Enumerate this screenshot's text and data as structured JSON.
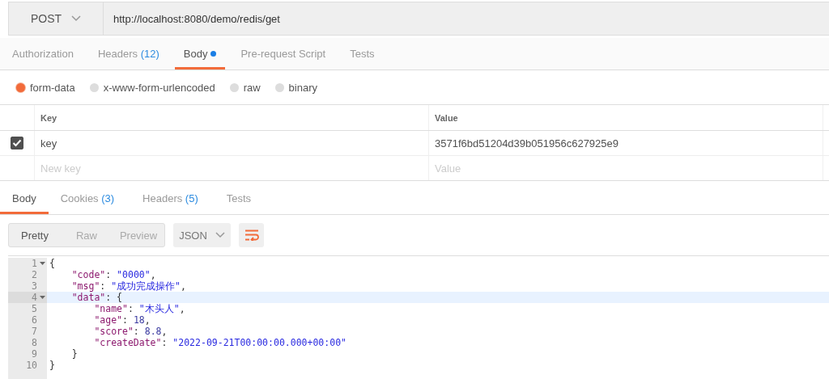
{
  "request": {
    "method": "POST",
    "url": "http://localhost:8080/demo/redis/get"
  },
  "request_tabs": [
    {
      "label": "Authorization",
      "dot": false,
      "selected": false
    },
    {
      "label": "Headers",
      "count": "(12)",
      "dot": false,
      "selected": false
    },
    {
      "label": "Body",
      "dot": true,
      "selected": true
    },
    {
      "label": "Pre-request Script",
      "dot": false,
      "selected": false
    },
    {
      "label": "Tests",
      "dot": false,
      "selected": false
    }
  ],
  "body_types": [
    {
      "label": "form-data",
      "selected": true
    },
    {
      "label": "x-www-form-urlencoded",
      "selected": false
    },
    {
      "label": "raw",
      "selected": false
    },
    {
      "label": "binary",
      "selected": false
    }
  ],
  "params": {
    "columns": [
      "Key",
      "Value"
    ],
    "rows": [
      {
        "checked": true,
        "key": "key",
        "value": "3571f6bd51204d39b051956c627925e9"
      }
    ],
    "new_row": {
      "key_placeholder": "New key",
      "value_placeholder": "Value"
    }
  },
  "response_tabs": [
    {
      "label": "Body",
      "selected": true
    },
    {
      "label": "Cookies",
      "count": "(3)",
      "selected": false
    },
    {
      "label": "Headers",
      "count": "(5)",
      "selected": false
    },
    {
      "label": "Tests",
      "selected": false
    }
  ],
  "view_modes": [
    {
      "label": "Pretty",
      "selected": true
    },
    {
      "label": "Raw",
      "selected": false
    },
    {
      "label": "Preview",
      "selected": false
    }
  ],
  "format": {
    "label": "JSON"
  },
  "code_lines": [
    {
      "number": "1",
      "fold": true,
      "active": false,
      "tokens": [
        {
          "kind": "punct",
          "text": "{"
        }
      ]
    },
    {
      "number": "2",
      "fold": false,
      "active": false,
      "tokens": [
        {
          "kind": "key",
          "text": "    \"code\""
        },
        {
          "kind": "punct",
          "text": ": "
        },
        {
          "kind": "string",
          "text": "\"0000\""
        },
        {
          "kind": "punct",
          "text": ","
        }
      ]
    },
    {
      "number": "3",
      "fold": false,
      "active": false,
      "tokens": [
        {
          "kind": "key",
          "text": "    \"msg\""
        },
        {
          "kind": "punct",
          "text": ": "
        },
        {
          "kind": "string",
          "text": "\"成功完成操作\""
        },
        {
          "kind": "punct",
          "text": ","
        }
      ]
    },
    {
      "number": "4",
      "fold": true,
      "active": true,
      "tokens": [
        {
          "kind": "key",
          "text": "    \"data\""
        },
        {
          "kind": "punct",
          "text": ": {"
        }
      ]
    },
    {
      "number": "5",
      "fold": false,
      "active": false,
      "tokens": [
        {
          "kind": "key",
          "text": "        \"name\""
        },
        {
          "kind": "punct",
          "text": ": "
        },
        {
          "kind": "string",
          "text": "\"木头人\""
        },
        {
          "kind": "punct",
          "text": ","
        }
      ]
    },
    {
      "number": "6",
      "fold": false,
      "active": false,
      "tokens": [
        {
          "kind": "key",
          "text": "        \"age\""
        },
        {
          "kind": "punct",
          "text": ": "
        },
        {
          "kind": "number",
          "text": "18"
        },
        {
          "kind": "punct",
          "text": ","
        }
      ]
    },
    {
      "number": "7",
      "fold": false,
      "active": false,
      "tokens": [
        {
          "kind": "key",
          "text": "        \"score\""
        },
        {
          "kind": "punct",
          "text": ": "
        },
        {
          "kind": "number",
          "text": "8.8"
        },
        {
          "kind": "punct",
          "text": ","
        }
      ]
    },
    {
      "number": "8",
      "fold": false,
      "active": false,
      "tokens": [
        {
          "kind": "key",
          "text": "        \"createDate\""
        },
        {
          "kind": "punct",
          "text": ": "
        },
        {
          "kind": "string",
          "text": "\"2022-09-21T00:00:00.000+00:00\""
        }
      ]
    },
    {
      "number": "9",
      "fold": false,
      "active": false,
      "tokens": [
        {
          "kind": "punct",
          "text": "    }"
        }
      ]
    },
    {
      "number": "10",
      "fold": false,
      "active": false,
      "tokens": [
        {
          "kind": "punct",
          "text": "}"
        }
      ]
    }
  ]
}
